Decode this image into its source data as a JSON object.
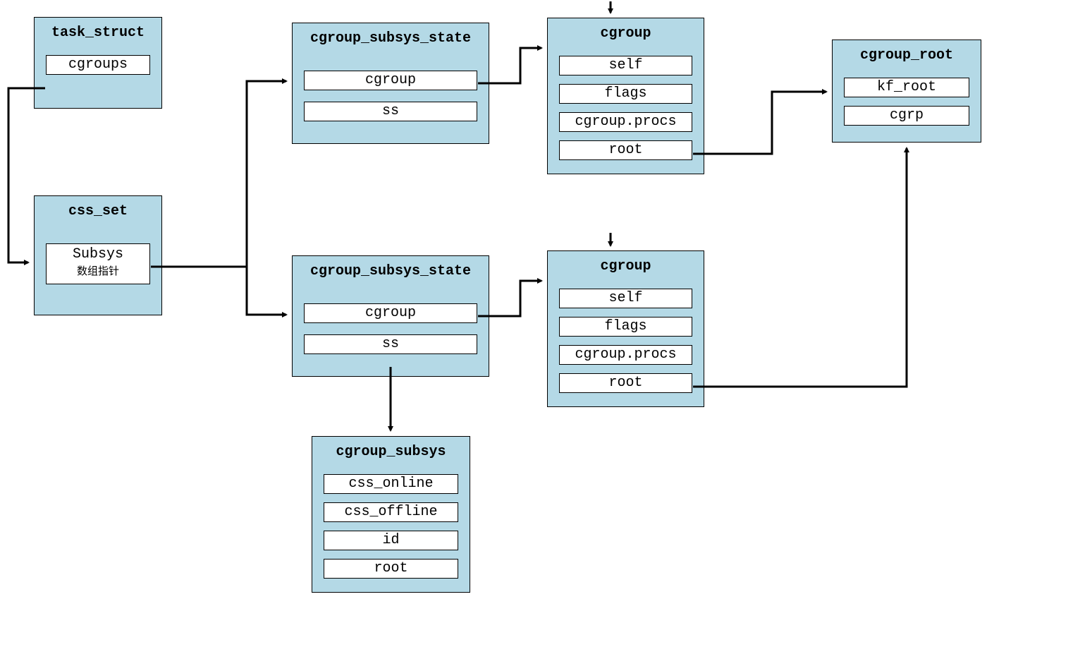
{
  "task_struct": {
    "title": "task_struct",
    "field0": "cgroups"
  },
  "css_set": {
    "title": "css_set",
    "subsys_label": "Subsys",
    "subsys_sub": "数组指针"
  },
  "css_state_top": {
    "title": "cgroup_subsys_state",
    "field0": "cgroup",
    "field1": "ss"
  },
  "css_state_bottom": {
    "title": "cgroup_subsys_state",
    "field0": "cgroup",
    "field1": "ss"
  },
  "cgroup_top": {
    "title": "cgroup",
    "field0": "self",
    "field1": "flags",
    "field2": "cgroup.procs",
    "field3": "root"
  },
  "cgroup_bottom": {
    "title": "cgroup",
    "field0": "self",
    "field1": "flags",
    "field2": "cgroup.procs",
    "field3": "root"
  },
  "cgroup_root": {
    "title": "cgroup_root",
    "field0": "kf_root",
    "field1": "cgrp"
  },
  "cgroup_subsys": {
    "title": "cgroup_subsys",
    "field0": "css_online",
    "field1": "css_offline",
    "field2": "id",
    "field3": "root"
  }
}
